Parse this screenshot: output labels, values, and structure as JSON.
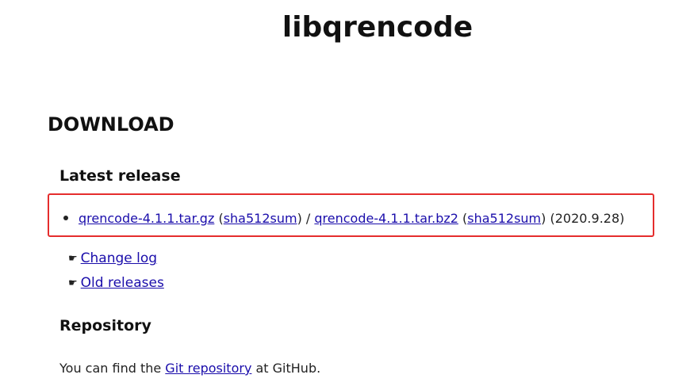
{
  "site": {
    "title": "libqrencode"
  },
  "download": {
    "heading": "DOWNLOAD",
    "latest": {
      "heading": "Latest release",
      "gz_label": "qrencode-4.1.1.tar.gz",
      "open_paren1": " (",
      "gz_sha_label": "sha512sum",
      "sep": ") / ",
      "bz2_label": "qrencode-4.1.1.tar.bz2",
      "open_paren2": " (",
      "bz2_sha_label": "sha512sum",
      "date": ") (2020.9.28)",
      "highlight_color": "#e52d2d"
    },
    "links": {
      "changelog_label": "Change log",
      "old_releases_label": "Old releases",
      "bullet_icon": "pointing-hand-icon"
    }
  },
  "repository": {
    "heading": "Repository",
    "text_before": "You can find the ",
    "link_label": "Git repository",
    "text_after": " at GitHub."
  },
  "colors": {
    "link": "#1a0dab",
    "text": "#1a1a1a"
  }
}
